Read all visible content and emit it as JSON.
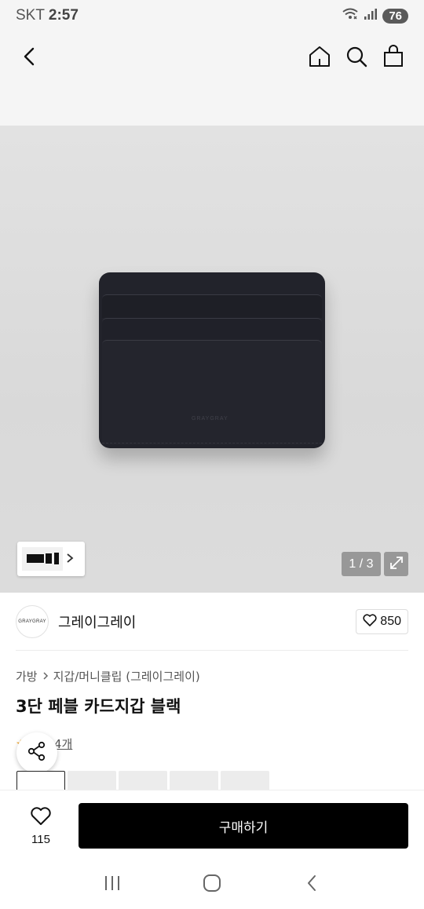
{
  "status_bar": {
    "carrier": "SKT",
    "time": "2:57",
    "battery": "76",
    "icons": [
      "wifi-icon",
      "signal-icon"
    ]
  },
  "header": {
    "icons": [
      "back-arrow-icon",
      "home-icon",
      "search-icon",
      "shopping-bag-icon"
    ]
  },
  "gallery": {
    "counter": "1 / 3",
    "wallet_logo": "GRAYGRAY",
    "icons": [
      "chevron-right-icon",
      "expand-icon"
    ]
  },
  "brand": {
    "logo_text": "GRAYGRAY",
    "name": "그레이그레이",
    "like_count": "850"
  },
  "breadcrumb": {
    "items": [
      "가방",
      "지갑/머니클립 (그레이그레이)"
    ]
  },
  "product": {
    "title": "3단 페블 카드지갑 블랙",
    "review_text": "후기 4개"
  },
  "bottom_bar": {
    "wish_count": "115",
    "buy_label": "구매하기"
  },
  "colors": {
    "buy_button": "#000000",
    "wallet": "#22232b",
    "background_header": "#f5f5f5"
  }
}
